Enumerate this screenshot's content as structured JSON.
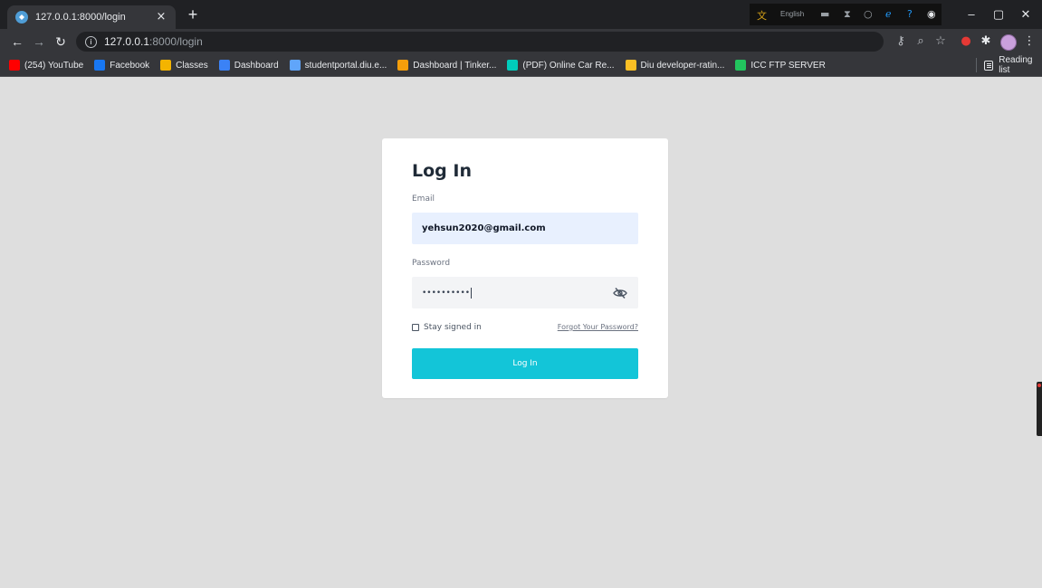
{
  "browser": {
    "tab_title": "127.0.0.1:8000/login",
    "close_glyph": "×",
    "new_tab_glyph": "+",
    "url_host": "127.0.0.1",
    "url_path": ":8000/login",
    "ext_label": "English",
    "bookmarks": [
      {
        "label": "(254) YouTube",
        "icon": "youtube-icon",
        "color": "#ff0000"
      },
      {
        "label": "Facebook",
        "icon": "facebook-icon",
        "color": "#1877f2"
      },
      {
        "label": "Classes",
        "icon": "classroom-icon",
        "color": "#f4b400"
      },
      {
        "label": "Dashboard",
        "icon": "dashboard-icon",
        "color": "#3b82f6"
      },
      {
        "label": "studentportal.diu.e...",
        "icon": "portal-icon",
        "color": "#60a5fa"
      },
      {
        "label": "Dashboard | Tinker...",
        "icon": "tinkercad-icon",
        "color": "#f59e0b"
      },
      {
        "label": "(PDF) Online Car Re...",
        "icon": "researchgate-icon",
        "color": "#00ccbb"
      },
      {
        "label": "Diu developer-ratin...",
        "icon": "diu-icon",
        "color": "#fbbf24"
      },
      {
        "label": "ICC FTP SERVER",
        "icon": "icc-icon",
        "color": "#22c55e"
      }
    ],
    "reading_list": "Reading list"
  },
  "login": {
    "title": "Log In",
    "email_label": "Email",
    "email_value": "yehsun2020@gmail.com",
    "password_label": "Password",
    "password_value": "••••••••••",
    "remember_label": "Stay signed in",
    "forgot_label": "Forgot Your Password?",
    "submit_label": "Log In"
  },
  "colors": {
    "accent": "#13c5d8",
    "page_bg": "#dedede",
    "email_bg": "#e8f0fe"
  }
}
